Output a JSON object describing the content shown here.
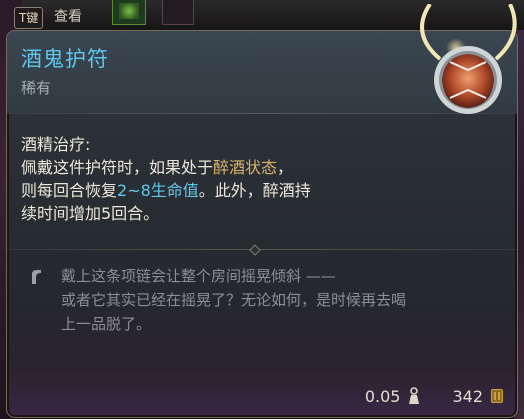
{
  "hotkey": {
    "key": "T键",
    "label": "查看"
  },
  "item": {
    "name": "酒鬼护符",
    "rarity": "稀有",
    "effect_title": "酒精治疗:",
    "effect_parts": {
      "p1": "佩戴这件护符时，如果处于",
      "p2": "醉酒状态",
      "p3": "，",
      "p4": "则每回合恢复",
      "p5": "2~8生命值",
      "p6": "。此外，醉酒持",
      "p7": "续时间增加5回合。"
    },
    "lore_lines": [
      "戴上这条项链会让整个房间摇晃倾斜 ——",
      "或者它其实已经在摇晃了？无论如何，是时候再去喝",
      "上一品脱了。"
    ],
    "weight": "0.05",
    "value": "342"
  },
  "colors": {
    "name": "#5ec7ee",
    "status_highlight": "#d8b36a",
    "heal_highlight": "#63c6ea",
    "lore": "#8b8f93"
  },
  "icons": {
    "lore": "feather-icon",
    "weight": "weight-icon",
    "value": "gold-coin-icon",
    "item": "amulet-icon"
  }
}
